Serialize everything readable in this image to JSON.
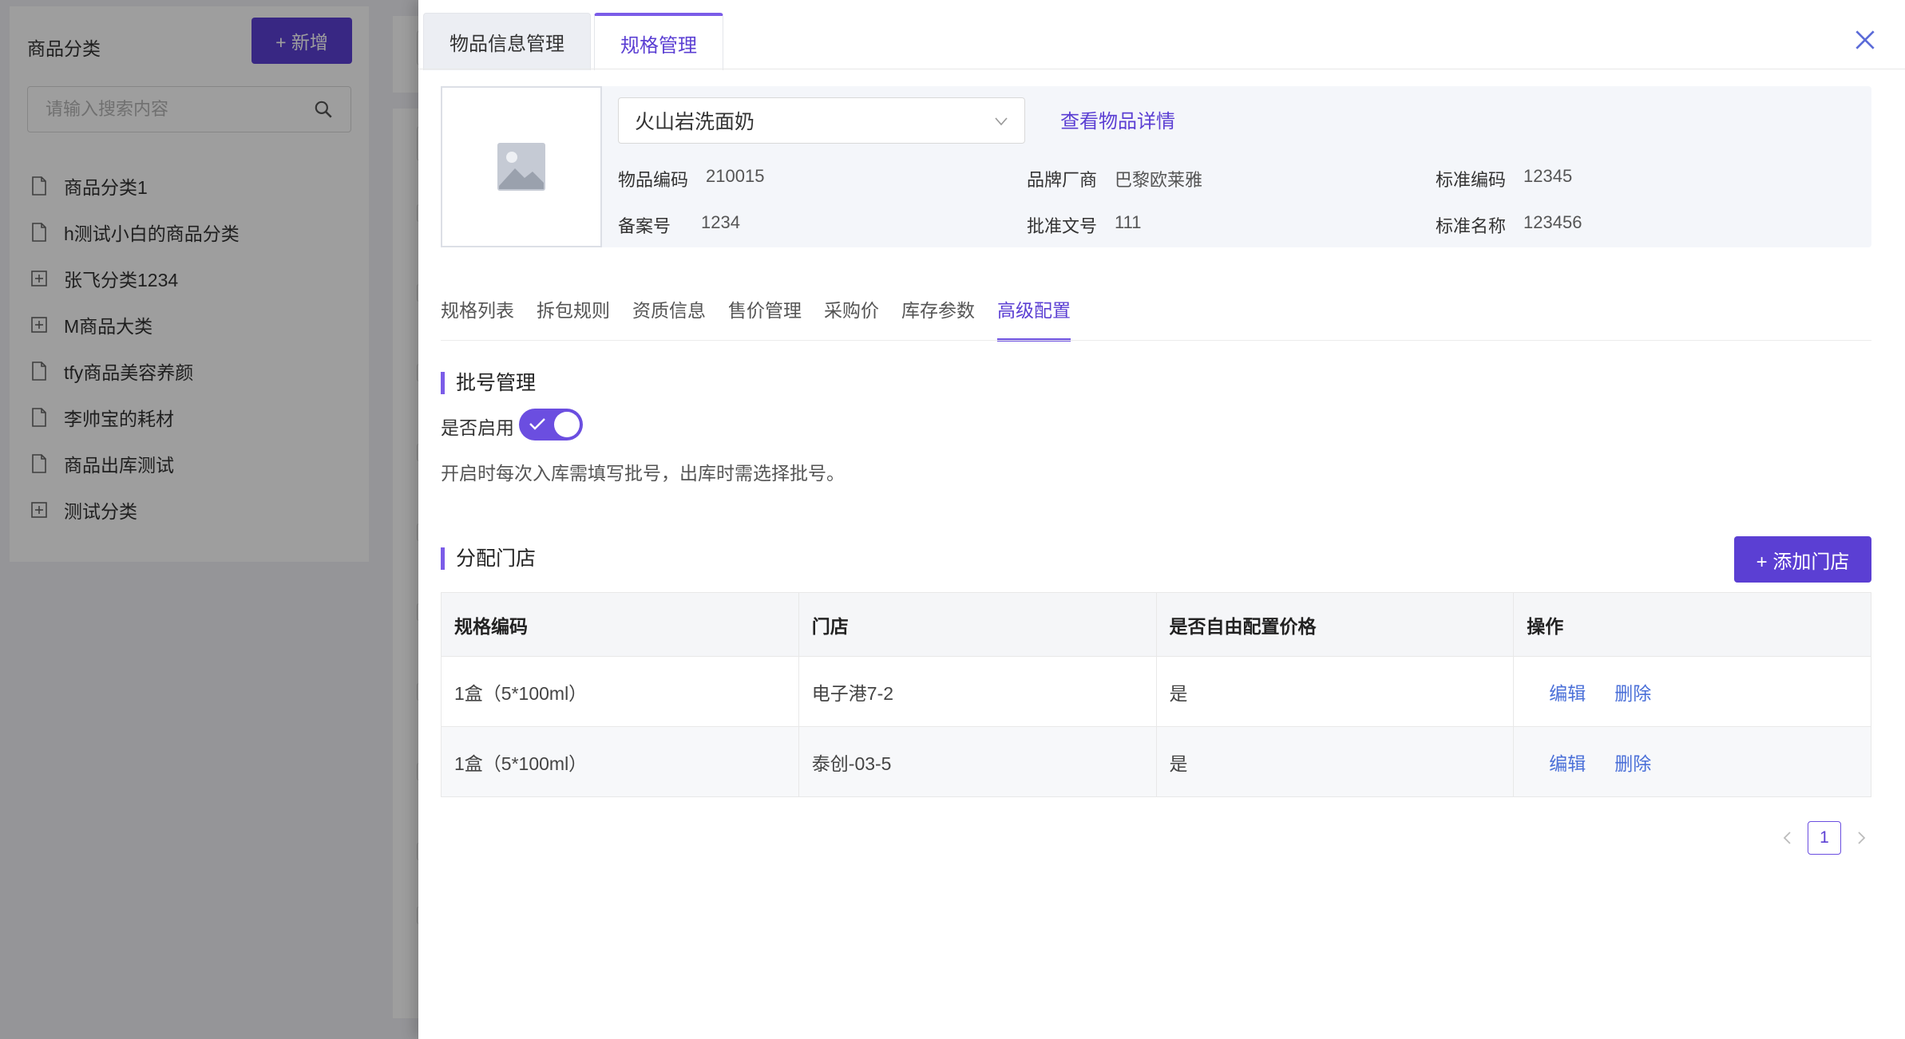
{
  "sidebar": {
    "title": "商品分类",
    "add_label": "+ 新增",
    "search_placeholder": "请输入搜索内容",
    "items": [
      {
        "label": "商品分类1",
        "icon": "file-icon"
      },
      {
        "label": "h测试小白的商品分类",
        "icon": "file-icon"
      },
      {
        "label": "张飞分类1234",
        "icon": "expand-plus-icon"
      },
      {
        "label": "M商品大类",
        "icon": "expand-plus-icon"
      },
      {
        "label": "tfy商品美容养颜",
        "icon": "file-icon"
      },
      {
        "label": "李帅宝的耗材",
        "icon": "file-icon"
      },
      {
        "label": "商品出库测试",
        "icon": "file-icon"
      },
      {
        "label": "测试分类",
        "icon": "expand-plus-icon"
      }
    ]
  },
  "drawer": {
    "tabs": [
      {
        "label": "物品信息管理",
        "active": false
      },
      {
        "label": "规格管理",
        "active": true
      }
    ],
    "product": {
      "name": "火山岩洗面奶",
      "detail_link": "查看物品详情",
      "fields": {
        "code_label": "物品编码",
        "code": "210015",
        "brand_label": "品牌厂商",
        "brand": "巴黎欧莱雅",
        "std_code_label": "标准编码",
        "std_code": "12345",
        "record_label": "备案号",
        "record": "1234",
        "approval_label": "批准文号",
        "approval": "111",
        "std_name_label": "标准名称",
        "std_name": "123456"
      }
    },
    "subtabs": [
      "规格列表",
      "拆包规则",
      "资质信息",
      "售价管理",
      "采购价",
      "库存参数",
      "高级配置"
    ],
    "active_subtab": "高级配置",
    "batch": {
      "title": "批号管理",
      "enable_label": "是否启用",
      "enabled": true,
      "hint": "开启时每次入库需填写批号，出库时需选择批号。"
    },
    "stores": {
      "title": "分配门店",
      "add_label": "+ 添加门店",
      "columns": [
        "规格编码",
        "门店",
        "是否自由配置价格",
        "操作"
      ],
      "rows": [
        {
          "spec": "1盒（5*100ml）",
          "store": "电子港7-2",
          "free_price": "是",
          "edit": "编辑",
          "delete": "删除"
        },
        {
          "spec": "1盒（5*100ml）",
          "store": "泰创-03-5",
          "free_price": "是",
          "edit": "编辑",
          "delete": "删除"
        }
      ]
    },
    "pagination": {
      "current": "1"
    }
  },
  "colors": {
    "accent": "#5b3fd3",
    "link": "#4a6fd8"
  }
}
